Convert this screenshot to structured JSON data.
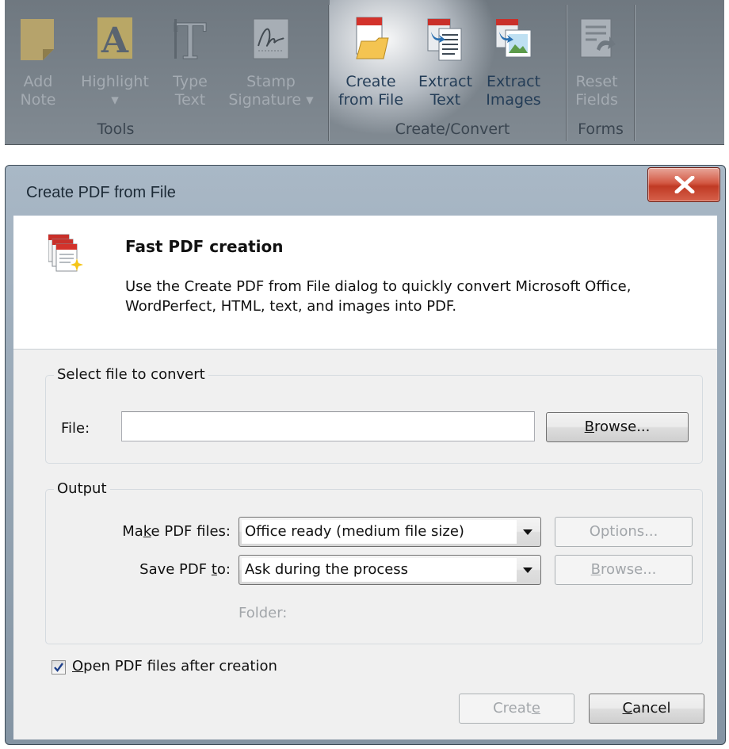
{
  "ribbon": {
    "groups": {
      "tools": "Tools",
      "create_convert": "Create/Convert",
      "forms": "Forms"
    },
    "buttons": {
      "add_note": "Add\nNote",
      "highlight": "Highlight\n▾",
      "type_text": "Type\nText",
      "stamp_signature": "Stamp\nSignature ▾",
      "create_from_file": "Create\nfrom File",
      "extract_text": "Extract\nText",
      "extract_images": "Extract\nImages",
      "reset_fields": "Reset\nFields"
    }
  },
  "dialog": {
    "title": "Create PDF from File",
    "header": {
      "title": "Fast PDF creation",
      "description": "Use the Create PDF from File dialog to quickly convert Microsoft Office, WordPerfect, HTML, text, and images into PDF."
    },
    "select_group": {
      "legend": "Select file to convert",
      "file_label": "File:",
      "file_value": "",
      "browse_label": "Browse..."
    },
    "output_group": {
      "legend": "Output",
      "make_pdf_label_pre": "Ma",
      "make_pdf_label_key": "k",
      "make_pdf_label_post": "e PDF files:",
      "make_pdf_value": "Office ready (medium file size)",
      "options_label": "Options...",
      "save_pdf_label_pre": "Save PDF ",
      "save_pdf_label_key": "t",
      "save_pdf_label_post": "o:",
      "save_pdf_value": "Ask during the process",
      "browse_label_key": "B",
      "browse_label_rest": "rowse...",
      "folder_label": "Folder:"
    },
    "open_after": {
      "label_key": "O",
      "label_rest": "pen PDF files after creation",
      "checked": true
    },
    "buttons": {
      "create_pre": "Creat",
      "create_key": "e",
      "cancel_key": "C",
      "cancel_rest": "ancel"
    }
  }
}
